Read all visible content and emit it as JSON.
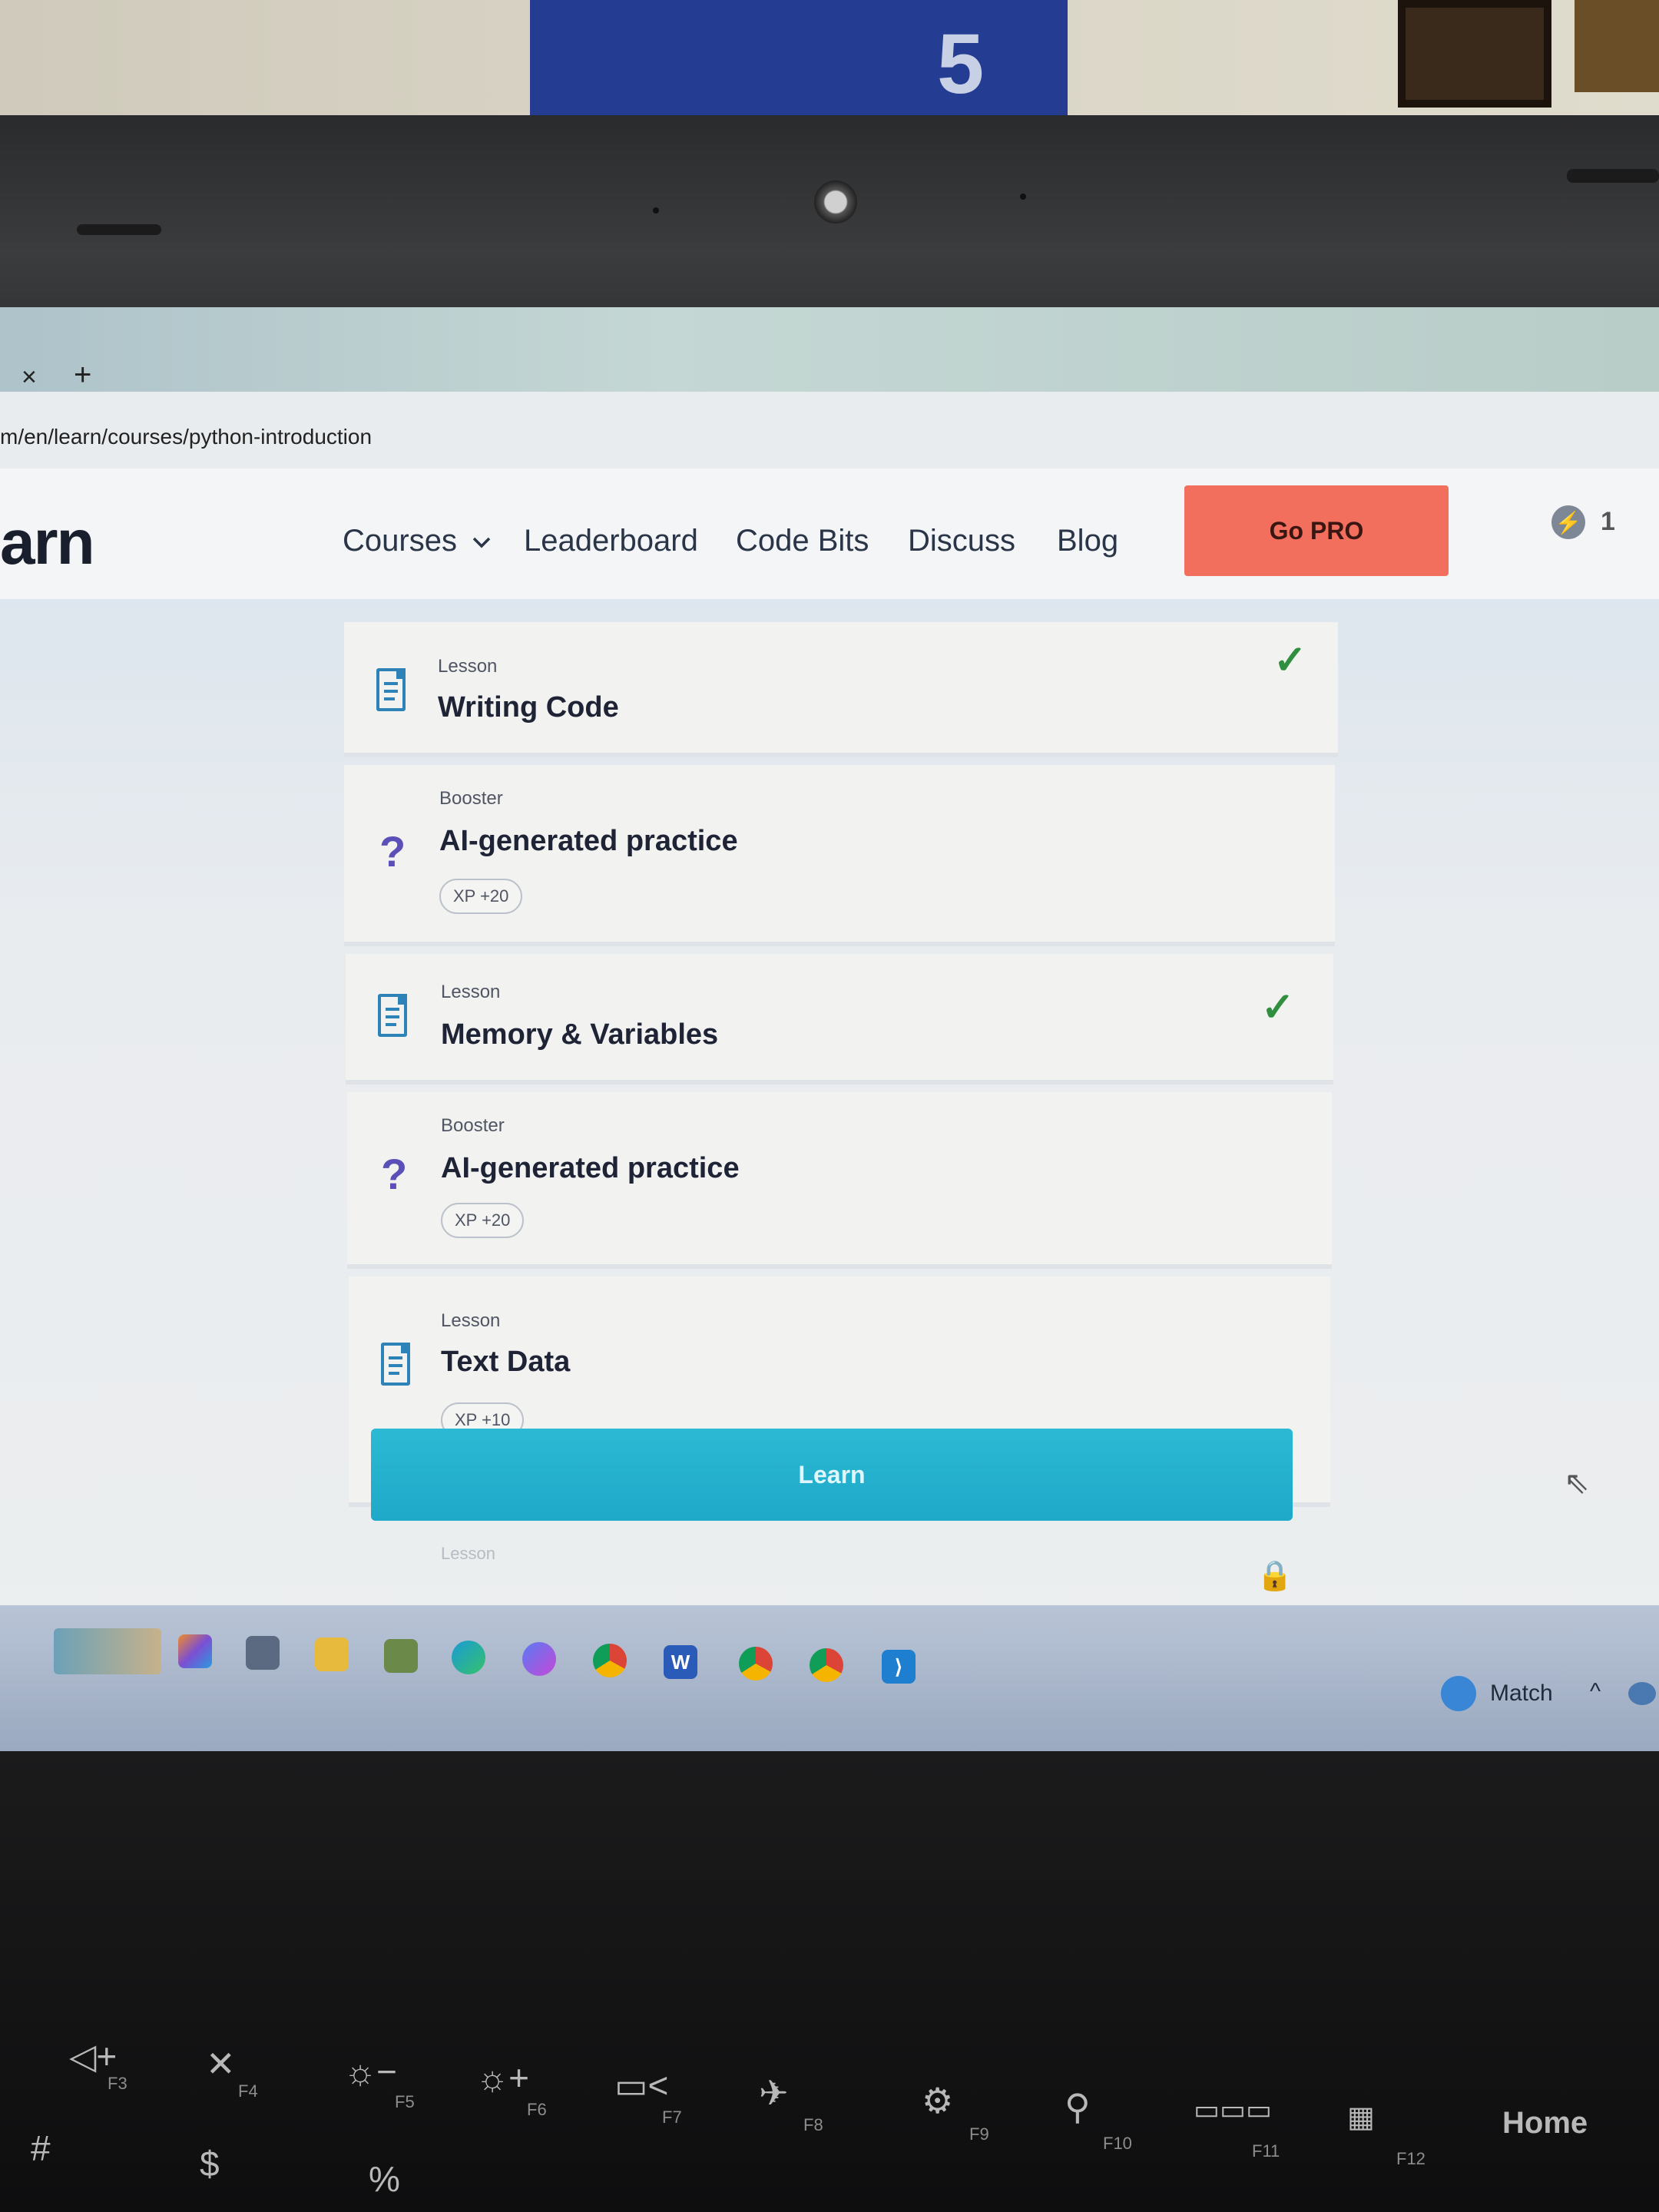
{
  "browser": {
    "tab_close": "×",
    "tab_new": "+",
    "url": "m/en/learn/courses/python-introduction"
  },
  "navbar": {
    "logo": "arn",
    "items": [
      "Courses",
      "Leaderboard",
      "Code Bits",
      "Discuss",
      "Blog"
    ],
    "courses_chevron": "⌄",
    "go_pro": "Go PRO",
    "bolt_count": "1"
  },
  "cards": [
    {
      "type": "Lesson",
      "title": "Writing Code",
      "icon": "lesson-icon",
      "completed": true
    },
    {
      "type": "Booster",
      "title": "AI-generated practice",
      "icon": "booster-icon",
      "xp": "XP +20"
    },
    {
      "type": "Lesson",
      "title": "Memory & Variables",
      "icon": "lesson-icon",
      "completed": true
    },
    {
      "type": "Booster",
      "title": "AI-generated practice",
      "icon": "booster-icon",
      "xp": "XP +20"
    },
    {
      "type": "Lesson",
      "title": "Text Data",
      "icon": "lesson-icon",
      "xp": "XP +10"
    }
  ],
  "learn_button": "Learn",
  "next_card_type": "Lesson",
  "taskbar": {
    "weather_label": "Match"
  },
  "keyboard": {
    "f3": "F3",
    "f4": "F4",
    "f5": "F5",
    "f6": "F6",
    "f7": "F7",
    "f8": "F8",
    "f9": "F9",
    "f10": "F10",
    "f11": "F11",
    "f12": "F12",
    "home": "Home"
  },
  "colors": {
    "accent": "#1ea9c8",
    "go_pro": "#f26f5d",
    "check": "#2f8f3e"
  }
}
